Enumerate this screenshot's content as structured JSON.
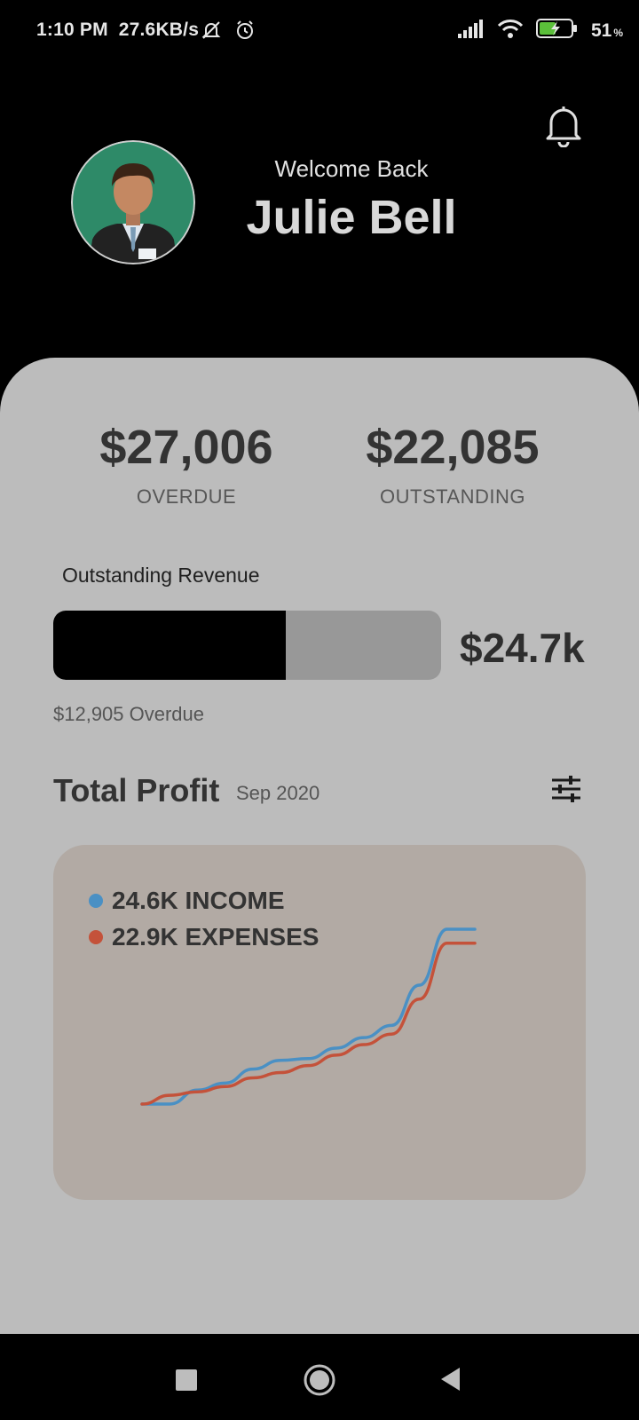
{
  "status_bar": {
    "time": "1:10 PM",
    "net_speed": "27.6KB/s",
    "battery_level": "51",
    "battery_unit": "%",
    "icons": [
      "mute-notifications-icon",
      "alarm-icon",
      "signal-icon",
      "wifi-icon",
      "battery-charging-icon"
    ]
  },
  "header": {
    "welcome": "Welcome Back",
    "user_name": "Julie Bell",
    "avatar": "businessman-avatar",
    "notification_icon": "bell-icon"
  },
  "summary": {
    "overdue_value": "$27,006",
    "overdue_label": "OVERDUE",
    "outstanding_value": "$22,085",
    "outstanding_label": "OUTSTANDING"
  },
  "revenue": {
    "title": "Outstanding Revenue",
    "total": "$24.7k",
    "overdue_text": "$12,905 Overdue",
    "fill_fraction": 0.6
  },
  "profit": {
    "title": "Total Profit",
    "date": "Sep 2020",
    "filter_icon": "sliders-icon",
    "legend": [
      {
        "label": "24.6K INCOME",
        "color": "#4a90c4"
      },
      {
        "label": "22.9K EXPENSES",
        "color": "#c4523a"
      }
    ]
  },
  "chart_data": {
    "type": "line",
    "x": [
      0,
      1,
      2,
      3,
      4,
      5,
      6,
      7,
      8,
      9,
      10,
      11,
      12
    ],
    "series": [
      {
        "name": "INCOME",
        "color": "#4a90c4",
        "values": [
          0.0,
          0.0,
          0.08,
          0.12,
          0.2,
          0.25,
          0.26,
          0.32,
          0.38,
          0.45,
          0.68,
          1.0,
          1.0
        ]
      },
      {
        "name": "EXPENSES",
        "color": "#c4523a",
        "values": [
          0.0,
          0.05,
          0.07,
          0.1,
          0.15,
          0.18,
          0.22,
          0.28,
          0.34,
          0.4,
          0.6,
          0.92,
          0.92
        ]
      }
    ],
    "grid": false
  },
  "nav": {
    "recents_icon": "recents-square-icon",
    "home_icon": "home-circle-icon",
    "back_icon": "back-triangle-icon"
  }
}
